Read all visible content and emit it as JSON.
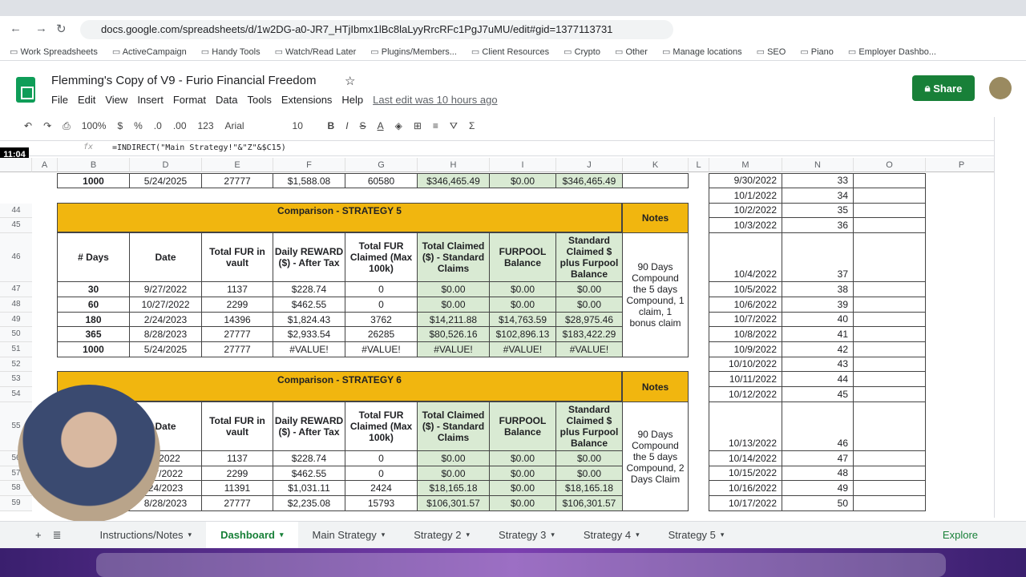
{
  "browser": {
    "url": "docs.google.com/spreadsheets/d/1w2DG-a0-JR7_HTjIbmx1lBc8laLyyRrcRFc1PgJ7uMU/edit#gid=1377113731",
    "bookmarks": [
      "Work Spreadsheets",
      "ActiveCampaign",
      "Handy Tools",
      "Watch/Read Later",
      "Plugins/Members...",
      "Client Resources",
      "Crypto",
      "Other",
      "Manage locations",
      "SEO",
      "Piano",
      "Employer Dashbo..."
    ]
  },
  "doc": {
    "title": "Flemming's Copy of V9 - Furio Financial Freedom",
    "menu": [
      "File",
      "Edit",
      "View",
      "Insert",
      "Format",
      "Data",
      "Tools",
      "Extensions",
      "Help"
    ],
    "last_edit": "Last edit was 10 hours ago",
    "share": "Share"
  },
  "toolbar": {
    "zoom": "100%",
    "currency": "$",
    "percent": "%",
    "dec_less": ".0",
    "dec_more": ".00",
    "format": "123",
    "font": "Arial",
    "size": "10",
    "bold": "B",
    "italic": "I",
    "strike": "S",
    "text_color": "A"
  },
  "formula_bar": {
    "fx": "fx",
    "formula": "=INDIRECT(\"Main Strategy!\"&\"Z\"&$C15)"
  },
  "timer": "11:04",
  "columns": [
    "A",
    "B",
    "D",
    "E",
    "F",
    "G",
    "H",
    "I",
    "J",
    "K",
    "L",
    "M",
    "N",
    "O",
    "P"
  ],
  "row_numbers": [
    "44",
    "45",
    "46",
    "47",
    "48",
    "49",
    "50",
    "51",
    "52",
    "53",
    "54",
    "55",
    "56",
    "57",
    "58",
    "59"
  ],
  "top_row": [
    "1000",
    "5/24/2025",
    "27777",
    "$1,588.08",
    "60580",
    "$346,465.49",
    "$0.00",
    "$346,465.49"
  ],
  "strategy5": {
    "title": "Comparison - STRATEGY 5",
    "notes_label": "Notes",
    "headers": [
      "# Days",
      "Date",
      "Total FUR in vault",
      "Daily REWARD ($) - After Tax",
      "Total FUR Claimed (Max 100k)",
      "Total Claimed ($) - Standard Claims",
      "FURPOOL Balance",
      "Standard Claimed $ plus Furpool Balance"
    ],
    "rows": [
      [
        "30",
        "9/27/2022",
        "1137",
        "$228.74",
        "0",
        "$0.00",
        "$0.00",
        "$0.00"
      ],
      [
        "60",
        "10/27/2022",
        "2299",
        "$462.55",
        "0",
        "$0.00",
        "$0.00",
        "$0.00"
      ],
      [
        "180",
        "2/24/2023",
        "14396",
        "$1,824.43",
        "3762",
        "$14,211.88",
        "$14,763.59",
        "$28,975.46"
      ],
      [
        "365",
        "8/28/2023",
        "27777",
        "$2,933.54",
        "26285",
        "$80,526.16",
        "$102,896.13",
        "$183,422.29"
      ],
      [
        "1000",
        "5/24/2025",
        "27777",
        "#VALUE!",
        "#VALUE!",
        "#VALUE!",
        "#VALUE!",
        "#VALUE!"
      ]
    ],
    "notes": "90 Days Compound the 5 days Compound, 1 claim, 1 bonus claim"
  },
  "strategy6": {
    "title": "Comparison - STRATEGY 6",
    "notes_label": "Notes",
    "headers": [
      "",
      "Date",
      "Total FUR in vault",
      "Daily REWARD ($) - After Tax",
      "Total FUR Claimed (Max 100k)",
      "Total Claimed ($) - Standard Claims",
      "FURPOOL Balance",
      "Standard Claimed $ plus Furpool Balance"
    ],
    "rows": [
      [
        "",
        "7/2022",
        "1137",
        "$228.74",
        "0",
        "$0.00",
        "$0.00",
        "$0.00"
      ],
      [
        "",
        "27/2022",
        "2299",
        "$462.55",
        "0",
        "$0.00",
        "$0.00",
        "$0.00"
      ],
      [
        "",
        "24/2023",
        "11391",
        "$1,031.11",
        "2424",
        "$18,165.18",
        "$0.00",
        "$18,165.18"
      ],
      [
        "",
        "8/28/2023",
        "27777",
        "$2,235.08",
        "15793",
        "$106,301.57",
        "$0.00",
        "$106,301.57"
      ]
    ],
    "notes": "90 Days Compound the 5 days Compound, 2 Days Claim"
  },
  "side_table": [
    [
      "9/30/2022",
      "33"
    ],
    [
      "10/1/2022",
      "34"
    ],
    [
      "10/2/2022",
      "35"
    ],
    [
      "10/3/2022",
      "36"
    ],
    [
      "10/4/2022",
      "37"
    ],
    [
      "10/5/2022",
      "38"
    ],
    [
      "10/6/2022",
      "39"
    ],
    [
      "10/7/2022",
      "40"
    ],
    [
      "10/8/2022",
      "41"
    ],
    [
      "10/9/2022",
      "42"
    ],
    [
      "10/10/2022",
      "43"
    ],
    [
      "10/11/2022",
      "44"
    ],
    [
      "10/12/2022",
      "45"
    ],
    [
      "10/13/2022",
      "46"
    ],
    [
      "10/14/2022",
      "47"
    ],
    [
      "10/15/2022",
      "48"
    ],
    [
      "10/16/2022",
      "49"
    ],
    [
      "10/17/2022",
      "50"
    ]
  ],
  "sheet_tabs": [
    "Instructions/Notes",
    "Dashboard",
    "Main Strategy",
    "Strategy 2",
    "Strategy 3",
    "Strategy 4",
    "Strategy 5"
  ],
  "active_tab": "Dashboard",
  "explore": "Explore",
  "colors": {
    "header_orange": "#f1b60f",
    "claimed_green": "#d9ead3",
    "share_green": "#188038"
  }
}
